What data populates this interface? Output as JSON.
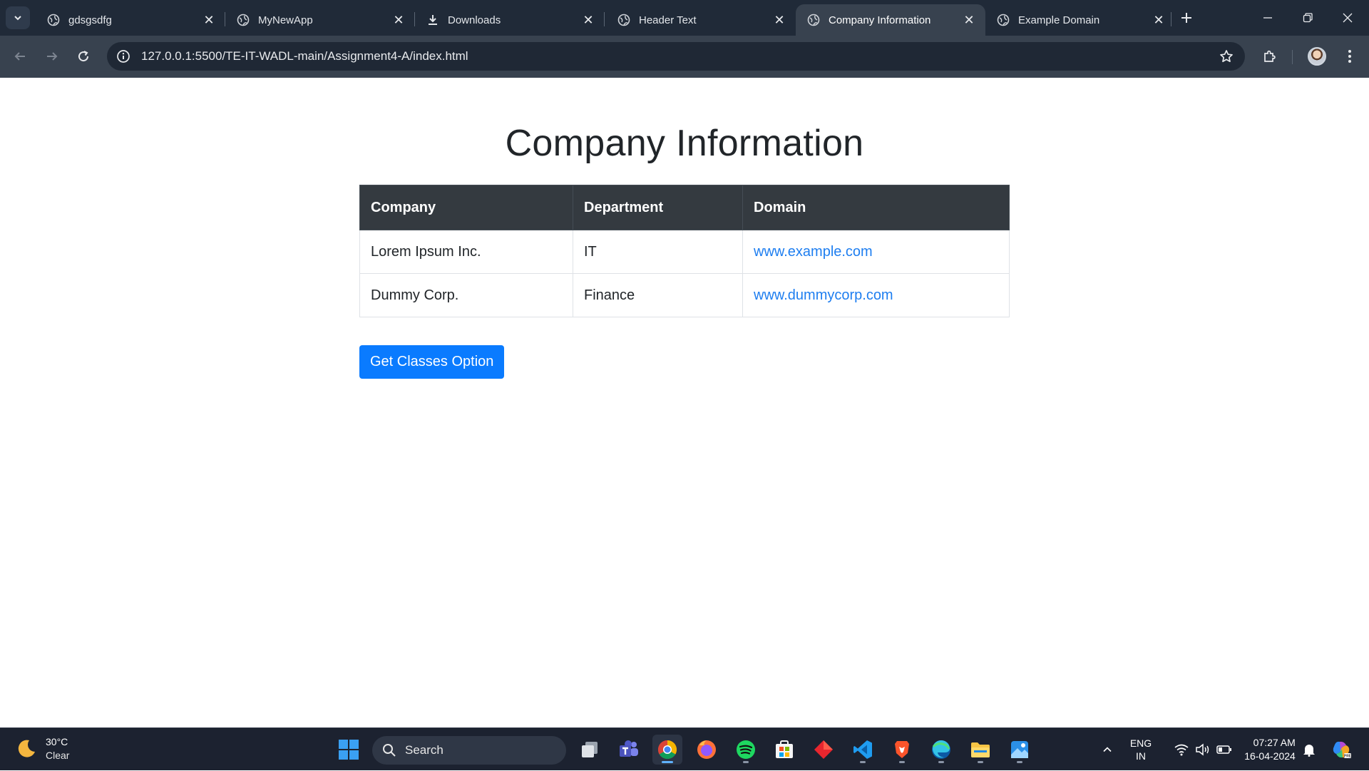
{
  "browser": {
    "tabs": [
      {
        "label": "gdsgsdfg",
        "icon": "globe-icon",
        "active": false
      },
      {
        "label": "MyNewApp",
        "icon": "globe-icon",
        "active": false
      },
      {
        "label": "Downloads",
        "icon": "download-icon",
        "active": false
      },
      {
        "label": "Header Text",
        "icon": "globe-icon",
        "active": false
      },
      {
        "label": "Company Information",
        "icon": "globe-icon",
        "active": true
      },
      {
        "label": "Example Domain",
        "icon": "globe-icon",
        "active": false
      }
    ],
    "url": "127.0.0.1:5500/TE-IT-WADL-main/Assignment4-A/index.html"
  },
  "page": {
    "title": "Company Information",
    "table": {
      "headers": [
        "Company",
        "Department",
        "Domain"
      ],
      "rows": [
        {
          "company": "Lorem Ipsum Inc.",
          "department": "IT",
          "domain": "www.example.com"
        },
        {
          "company": "Dummy Corp.",
          "department": "Finance",
          "domain": "www.dummycorp.com"
        }
      ]
    },
    "button_label": "Get Classes Option"
  },
  "taskbar": {
    "weather": {
      "temp": "30°C",
      "condition": "Clear"
    },
    "search_placeholder": "Search",
    "lang_line1": "ENG",
    "lang_line2": "IN",
    "time": "07:27 AM",
    "date": "16-04-2024",
    "apps": [
      "windows-start-icon",
      "task-view-icon",
      "teams-icon",
      "chrome-icon",
      "firefox-icon",
      "spotify-icon",
      "microsoft-store-icon",
      "app-diamond-icon",
      "vscode-icon",
      "brave-icon",
      "edge-icon",
      "file-explorer-icon",
      "photos-icon"
    ]
  },
  "colors": {
    "accent": "#0a7bff",
    "link": "#1e7ef0",
    "table_header": "#343a40",
    "chrome_dark": "#202a38"
  }
}
